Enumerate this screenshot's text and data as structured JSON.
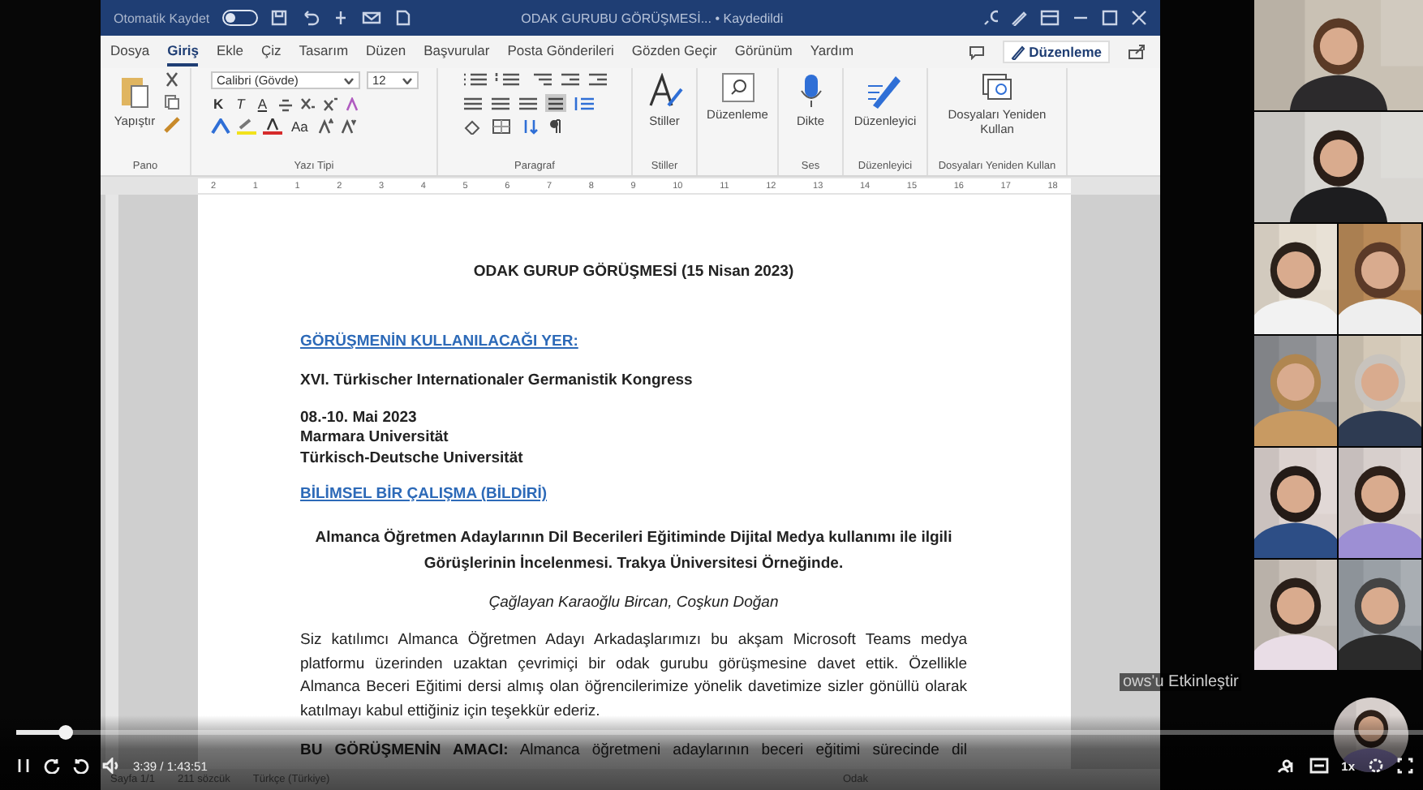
{
  "title_bar": {
    "autosave": {
      "label": "Otomatik Kaydet",
      "on": false
    },
    "doc_title": "ODAK GURUBU GÖRÜŞMESİ... • Kaydedildi"
  },
  "tabs": [
    {
      "label": "Dosya",
      "selected": false
    },
    {
      "label": "Giriş",
      "selected": true
    },
    {
      "label": "Ekle",
      "selected": false
    },
    {
      "label": "Çiz",
      "selected": false
    },
    {
      "label": "Tasarım",
      "selected": false
    },
    {
      "label": "Düzen",
      "selected": false
    },
    {
      "label": "Başvurular",
      "selected": false
    },
    {
      "label": "Posta Gönderileri",
      "selected": false
    },
    {
      "label": "Gözden Geçir",
      "selected": false
    },
    {
      "label": "Görünüm",
      "selected": false
    },
    {
      "label": "Yardım",
      "selected": false
    }
  ],
  "editing_mode": "Düzenleme",
  "ribbon": {
    "groups": [
      {
        "kind": "clipboard",
        "label": "Pano",
        "button": "Yapıştır"
      },
      {
        "kind": "font",
        "label": "Yazı Tipi",
        "font": "Calibri (Gövde)",
        "size": "12",
        "format": [
          "K",
          "T",
          "A"
        ],
        "case": "Aa"
      },
      {
        "kind": "paragraph",
        "label": "Paragraf"
      },
      {
        "kind": "styles",
        "label": "Stiller",
        "button": "Stiller"
      },
      {
        "kind": "find",
        "button": "Düzenleme"
      },
      {
        "kind": "dictate",
        "label": "Ses",
        "button": "Dikte"
      },
      {
        "kind": "editor",
        "label": "Düzenleyici",
        "button": "Düzenleyici"
      },
      {
        "kind": "reuse",
        "label": "Dosyaları Yeniden Kullan",
        "button": "Dosyaları Yeniden Kullan"
      }
    ]
  },
  "ruler": {
    "labels": [
      "2",
      "1",
      "1",
      "2",
      "3",
      "4",
      "5",
      "6",
      "7",
      "8",
      "9",
      "10",
      "11",
      "12",
      "13",
      "14",
      "15",
      "16",
      "17",
      "18"
    ]
  },
  "document": {
    "title": "ODAK GURUP GÖRÜŞMESİ (15 Nisan 2023)",
    "blocks": [
      {
        "kind": "heading",
        "text": "GÖRÜŞMENİN KULLANILACAĞI YER:"
      },
      {
        "kind": "lines",
        "lines": [
          "XVI. Türkischer Internationaler Germanistik Kongress"
        ]
      },
      {
        "kind": "lines",
        "lines": [
          "08.-10. Mai 2023",
          "Marmara Universität",
          "Türkisch-Deutsche Universität"
        ]
      },
      {
        "kind": "heading",
        "text": "BİLİMSEL BİR ÇALIŞMA (BİLDİRİ)"
      },
      {
        "kind": "center_bold",
        "text": "Almanca Öğretmen Adaylarının Dil Becerileri Eğitiminde Dijital Medya kullanımı ile ilgili Görüşlerinin İncelenmesi. Trakya Üniversitesi Örneğinde."
      },
      {
        "kind": "center_italic",
        "text": "Çağlayan Karaoğlu Bircan, Coşkun Doğan"
      },
      {
        "kind": "paragraph",
        "text": "Siz katılımcı Almanca Öğretmen Adayı Arkadaşlarımızı bu akşam Microsoft Teams medya platformu üzerinden uzaktan çevrimiçi bir odak gurubu görüşmesine davet ettik. Özellikle Almanca Beceri Eğitimi dersi almış olan öğrencilerimize yönelik davetimize sizler gönüllü olarak katılmayı kabul ettiğiniz için teşekkür ederiz."
      },
      {
        "kind": "cut_paragraph",
        "text": "**BU GÖRÜŞMENİN AMACI:** Almanca öğretmeni adaylarının beceri eğitimi sürecinde dil"
      }
    ]
  },
  "status_bar": {
    "items": [
      "Sayfa 1/1",
      "211 sözcük",
      "Türkçe (Türkiye)"
    ],
    "focus": "Odak"
  },
  "os_notice": "ows'u Etkinleştir",
  "player": {
    "level": 0.035,
    "time": "3:39 / 1:43:51",
    "speed": "1x"
  }
}
